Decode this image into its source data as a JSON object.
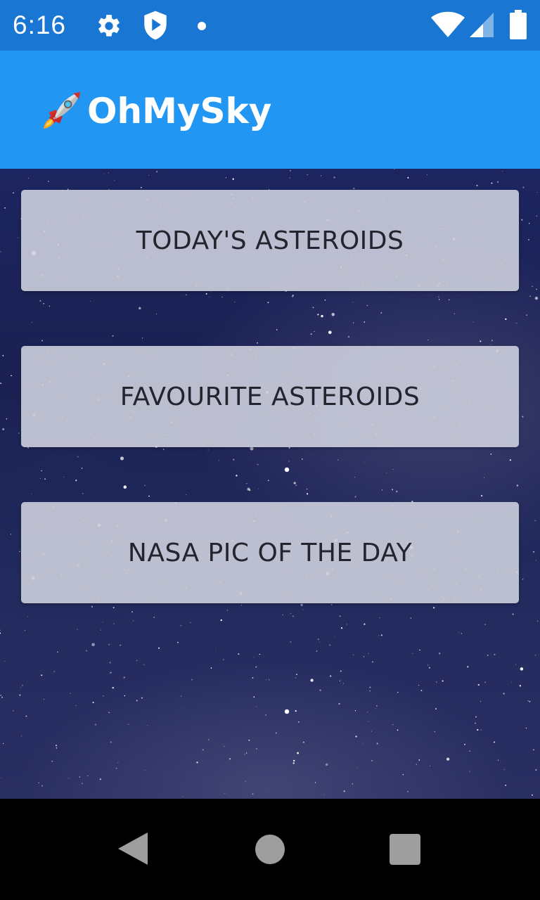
{
  "status_bar": {
    "time": "6:16",
    "icons": [
      "gear-icon",
      "shield-play-icon",
      "notification-dot-icon",
      "wifi-icon",
      "signal-icon",
      "battery-icon"
    ]
  },
  "app_bar": {
    "title": "OhMySky",
    "title_icon": "rocket-icon",
    "background": "#2196F3"
  },
  "menu": {
    "buttons": [
      {
        "label": "TODAY'S ASTEROIDS"
      },
      {
        "label": "FAVOURITE ASTEROIDS"
      },
      {
        "label": "NASA PIC OF THE DAY"
      }
    ]
  },
  "nav_bar": {
    "buttons": [
      "back-icon",
      "home-icon",
      "recents-icon"
    ]
  },
  "colors": {
    "status_bar": "#1976D2",
    "app_bar": "#2196F3",
    "button_bg": "#CDCFDD",
    "button_text": "#24242E"
  }
}
